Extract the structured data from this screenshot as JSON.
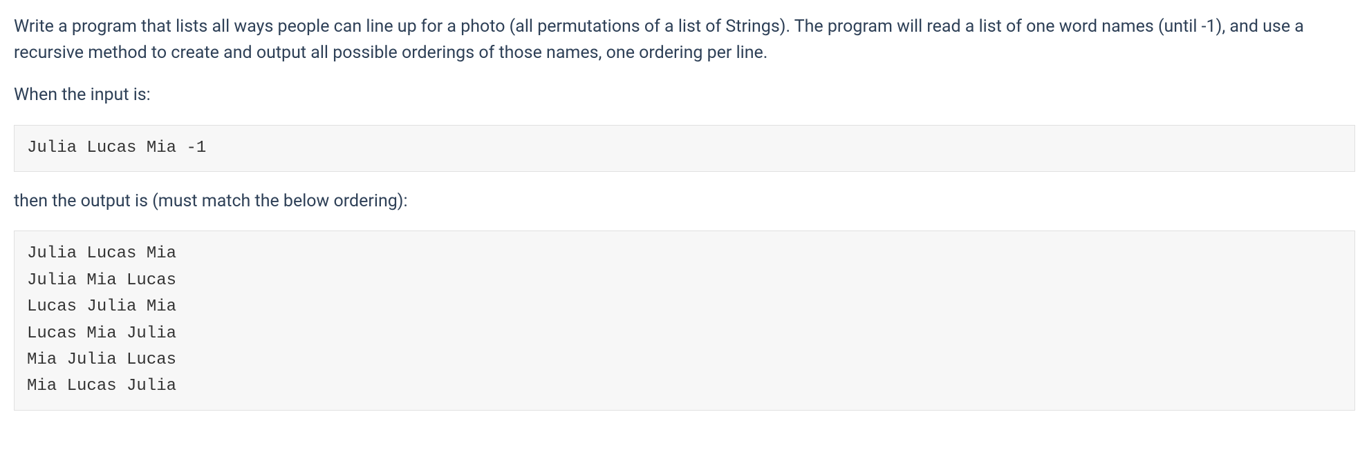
{
  "content": {
    "intro_paragraph": "Write a program that lists all ways people can line up for a photo (all permutations of a list of Strings). The program will read a list of one word names (until -1), and use a recursive method to create and output all possible orderings of those names, one ordering per line.",
    "input_label": "When the input is:",
    "input_code": "Julia Lucas Mia -1",
    "output_label": "then the output is (must match the below ordering):",
    "output_code": "Julia Lucas Mia \nJulia Mia Lucas \nLucas Julia Mia \nLucas Mia Julia \nMia Julia Lucas \nMia Lucas Julia "
  }
}
